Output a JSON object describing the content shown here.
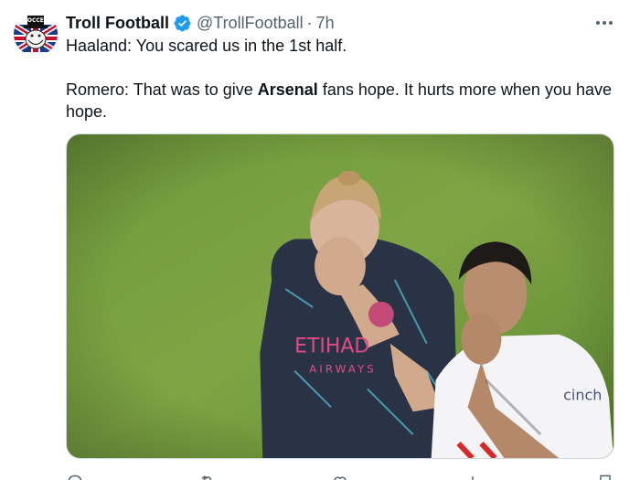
{
  "tweet": {
    "author": {
      "name": "Troll Football",
      "handle": "@TrollFootball",
      "dot": "·",
      "time": "7h",
      "verified": true,
      "avatar_label": "SOCCER"
    },
    "text": {
      "line1": "Haaland: You scared us in the 1st half.",
      "line2_prefix": "Romero: That was to give ",
      "line2_bold": "Arsenal",
      "line2_suffix": " fans hope. It hurts more when you have hope."
    },
    "media": {
      "alt": "Photo of two football players on a pitch covering their faces",
      "shirt_text_left": "ETIHAD",
      "shirt_text_left_sub": "AIRWAYS",
      "shirt_text_right": "cinch"
    },
    "actions": {
      "reply_icon": "reply-icon",
      "retweet_icon": "retweet-icon",
      "like_icon": "like-icon",
      "views_icon": "views-icon",
      "bookmark_icon": "bookmark-icon",
      "share_icon": "share-icon"
    },
    "colors": {
      "verified": "#1d9bf0",
      "secondary_text": "#536471",
      "primary_text": "#0f1419"
    }
  }
}
